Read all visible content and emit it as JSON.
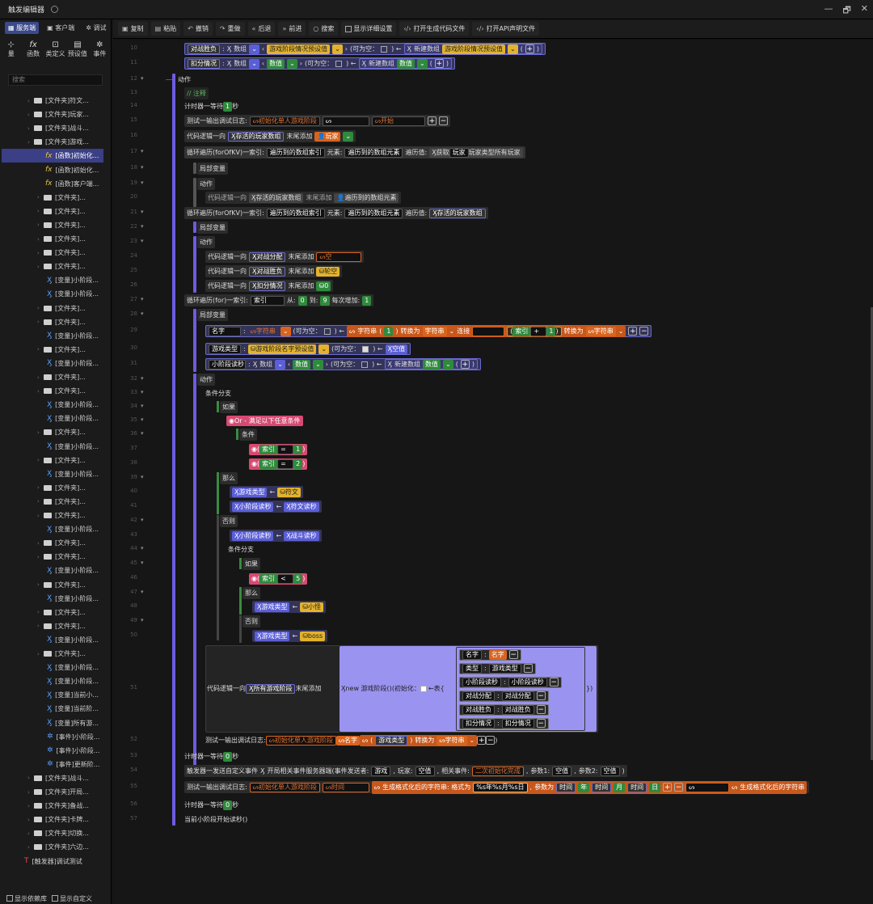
{
  "window": {
    "title": "触发编辑器",
    "controls": [
      "—",
      "🗗",
      "✕"
    ]
  },
  "left": {
    "tabs": [
      "服务端",
      "客户端",
      "调试"
    ],
    "tool_buttons": [
      "量",
      "函数",
      "类定义",
      "预设值",
      "事件"
    ],
    "search_placeholder": "搜索",
    "tree": [
      {
        "k": "folder",
        "t": "[文件夹]符文..."
      },
      {
        "k": "folder",
        "t": "[文件夹]玩家..."
      },
      {
        "k": "folder",
        "t": "[文件夹]战斗..."
      },
      {
        "k": "folder",
        "t": "[文件夹]游戏..."
      },
      {
        "k": "fx",
        "t": "[函数]初始化..."
      },
      {
        "k": "fx",
        "t": "[函数]初始化..."
      },
      {
        "k": "fx",
        "t": "[函数]客户端..."
      },
      {
        "k": "folder",
        "t": "[文件夹]..."
      },
      {
        "k": "folder",
        "t": "[文件夹]..."
      },
      {
        "k": "folder",
        "t": "[文件夹]..."
      },
      {
        "k": "folder",
        "t": "[文件夹]..."
      },
      {
        "k": "folder",
        "t": "[文件夹]..."
      },
      {
        "k": "folder",
        "t": "[文件夹]..."
      },
      {
        "k": "var",
        "t": "[变量]小阶段..."
      },
      {
        "k": "var",
        "t": "[变量]小阶段..."
      },
      {
        "k": "folder",
        "t": "[文件夹]..."
      },
      {
        "k": "folder",
        "t": "[文件夹]..."
      },
      {
        "k": "var",
        "t": "[变量]小阶段..."
      },
      {
        "k": "folder",
        "t": "[文件夹]..."
      },
      {
        "k": "var",
        "t": "[变量]小阶段..."
      },
      {
        "k": "folder",
        "t": "[文件夹]..."
      },
      {
        "k": "folder",
        "t": "[文件夹]..."
      },
      {
        "k": "var",
        "t": "[变量]小阶段..."
      },
      {
        "k": "var",
        "t": "[变量]小阶段..."
      },
      {
        "k": "folder",
        "t": "[文件夹]..."
      },
      {
        "k": "var",
        "t": "[变量]小阶段..."
      },
      {
        "k": "folder",
        "t": "[文件夹]..."
      },
      {
        "k": "var",
        "t": "[变量]小阶段..."
      },
      {
        "k": "folder",
        "t": "[文件夹]..."
      },
      {
        "k": "folder",
        "t": "[文件夹]..."
      },
      {
        "k": "folder",
        "t": "[文件夹]..."
      },
      {
        "k": "var",
        "t": "[变量]小阶段..."
      },
      {
        "k": "folder",
        "t": "[文件夹]..."
      },
      {
        "k": "folder",
        "t": "[文件夹]..."
      },
      {
        "k": "var",
        "t": "[变量]小阶段..."
      },
      {
        "k": "folder",
        "t": "[文件夹]..."
      },
      {
        "k": "var",
        "t": "[变量]小阶段..."
      },
      {
        "k": "folder",
        "t": "[文件夹]..."
      },
      {
        "k": "folder",
        "t": "[文件夹]..."
      },
      {
        "k": "var",
        "t": "[变量]小阶段..."
      },
      {
        "k": "folder",
        "t": "[文件夹]..."
      },
      {
        "k": "var",
        "t": "[变量]小阶段..."
      },
      {
        "k": "var",
        "t": "[变量]小阶段..."
      },
      {
        "k": "var",
        "t": "[变量]当前小..."
      },
      {
        "k": "var",
        "t": "[变量]当前阶..."
      },
      {
        "k": "var",
        "t": "[变量]所有游..."
      },
      {
        "k": "evt",
        "t": "[事件]小阶段..."
      },
      {
        "k": "evt",
        "t": "[事件]小阶段..."
      },
      {
        "k": "evt",
        "t": "[事件]更新阶..."
      },
      {
        "k": "folder",
        "t": "[文件夹]战斗..."
      },
      {
        "k": "folder",
        "t": "[文件夹]开局..."
      },
      {
        "k": "folder",
        "t": "[文件夹]备战..."
      },
      {
        "k": "folder",
        "t": "[文件夹]卡牌..."
      },
      {
        "k": "folder",
        "t": "[文件夹]切换..."
      },
      {
        "k": "folder",
        "t": "[文件夹]六边..."
      },
      {
        "k": "ttl",
        "t": "[触发器]调试测试"
      }
    ],
    "bottom": [
      "显示依赖库",
      "显示自定义"
    ]
  },
  "toolbar": [
    "复制",
    "粘贴",
    "撤销",
    "重做",
    "后退",
    "前进",
    "搜索",
    "显示详细设置",
    "打开生成代码文件",
    "打开API声明文件"
  ],
  "code": {
    "lines": [
      10,
      11,
      12,
      13,
      14,
      15,
      16,
      17,
      18,
      19,
      20,
      21,
      22,
      23,
      24,
      25,
      26,
      27,
      28,
      29,
      30,
      31,
      32,
      33,
      34,
      35,
      36,
      37,
      38,
      39,
      40,
      41,
      42,
      43,
      44,
      45,
      46,
      47,
      48,
      49,
      50,
      51,
      52,
      53,
      54,
      55,
      56,
      57
    ],
    "r10": {
      "name": "对战胜负",
      "t1": "数组",
      "t2": "游戏阶段情况预设值",
      "opt": "(可为空：",
      "new": "新建数组",
      "t3": "游戏阶段情况预设值"
    },
    "r11": {
      "name": "扣分情况",
      "t1": "数组",
      "t2": "数值",
      "opt": "(可为空：",
      "new": "新建数组",
      "t3": "数值"
    },
    "r12": "动作",
    "r13": "// 注释",
    "r14": {
      "a": "计时器一等待",
      "v": "1",
      "u": "秒"
    },
    "r15": {
      "a": "测试一输出调试日志:",
      "s1": "初始化单人游戏阶段",
      "s3": "开始"
    },
    "r16": {
      "a": "代码逻辑一向",
      "v": "存活的玩家数组",
      "b": "末尾添加",
      "p": "玩家"
    },
    "r17": {
      "a": "循环遍历(forOfKV)一索引:",
      "i": "遍历到的数组索引",
      "e": "元素:",
      "ev": "遍历到的数组元素",
      "s": "遍历值:",
      "g": "获取",
      "pl": "玩家",
      "pa": "玩家类型所有玩家"
    },
    "r18": "局部变量",
    "r19": "动作",
    "r20": {
      "a": "代码逻辑一向",
      "v": "存活的玩家数组",
      "b": "末尾添加",
      "p": "遍历到的数组元素"
    },
    "r21": {
      "a": "循环遍历(forOfKV)一索引:",
      "i": "遍历到的数组索引",
      "e": "元素:",
      "ev": "遍历到的数组元素",
      "s": "遍历值:",
      "sv": "存活的玩家数组"
    },
    "r22": "局部变量",
    "r23": "动作",
    "r24": {
      "a": "代码逻辑一向",
      "v": "对战分配",
      "b": "末尾添加",
      "p": "空"
    },
    "r25": {
      "a": "代码逻辑一向",
      "v": "对战胜负",
      "b": "末尾添加",
      "p": "轮空"
    },
    "r26": {
      "a": "代码逻辑一向",
      "v": "扣分情况",
      "b": "末尾添加",
      "p": "0"
    },
    "r27": {
      "a": "循环遍历(for)一索引:",
      "i": "索引",
      "f": "从:",
      "fv": "0",
      "to": "到:",
      "tv": "9",
      "st": "每次增加:",
      "sv": "1"
    },
    "r28": "局部变量",
    "r29": {
      "n": "名字",
      "t": "字符串",
      "opt": "(可为空：",
      "s": "字符串",
      "c": "转换为",
      "s2": "字符串",
      "cat": "连接",
      "idx": "索引",
      "op": "+",
      "v": "1",
      "s3": "字符串",
      "one": "1"
    },
    "r30": {
      "n": "游戏类型",
      "t": "游戏阶段名字预设值",
      "opt": "(可为空：",
      "v": "空值"
    },
    "r31": {
      "n": "小阶段读秒",
      "t1": "数组",
      "t2": "数值",
      "opt": "(可为空：",
      "new": "新建数组",
      "t3": "数值"
    },
    "r32": "动作",
    "r33": "条件分支",
    "r34": "如果",
    "r35": "Or - 满足以下任意条件",
    "r36": "条件",
    "r37": {
      "i": "索引",
      "op": "=",
      "v": "1"
    },
    "r38": {
      "i": "索引",
      "op": "=",
      "v": "2"
    },
    "r39": "那么",
    "r40": {
      "v": "游戏类型",
      "p": "符文"
    },
    "r41": {
      "v": "小阶段读秒",
      "p": "符文读秒"
    },
    "r42": "否则",
    "r43": {
      "v": "小阶段读秒",
      "p": "战斗读秒"
    },
    "r44": "条件分支",
    "r45": "如果",
    "r46": {
      "i": "索引",
      "op": "<",
      "v": "5"
    },
    "r47": "那么",
    "r48": {
      "v": "游戏类型",
      "p": "小怪"
    },
    "r49": "否则",
    "r50": {
      "v": "游戏类型",
      "p": "boss"
    },
    "r51": {
      "a": "代码逻辑一向",
      "v": "所有游戏阶段",
      "b": "末尾添加",
      "new": "new 游戏阶段()",
      "init": "(初始化：",
      "tbl": "表{",
      "fields": [
        [
          "名字",
          "名字"
        ],
        [
          "类型",
          "游戏类型"
        ],
        [
          "小阶段读秒",
          "小阶段读秒"
        ],
        [
          "对战分配",
          "对战分配"
        ],
        [
          "对战胜负",
          "对战胜负"
        ],
        [
          "扣分情况",
          "扣分情况"
        ]
      ]
    },
    "r52": {
      "a": "测试一输出调试日志:",
      "s1": "初始化单人游戏阶段",
      "s2": "名字",
      "v": "游戏类型",
      "c": "转换为",
      "s3": "字符串"
    },
    "r53": {
      "a": "计时器一等待",
      "v": "0",
      "u": "秒"
    },
    "r54": {
      "a": "触发器一发送自定义事件",
      "e": "开局相关事件服务器端(事件发送者:",
      "s": "游戏",
      "p": "玩家:",
      "pv": "空值",
      "r": "相关事件:",
      "rv": "二次初始化完成",
      "p1": "参数1:",
      "p1v": "空值",
      "p2": "参数2:",
      "p2v": "空值"
    },
    "r55": {
      "a": "测试一输出调试日志:",
      "s1": "初始化单人游戏阶段",
      "s2": "时间",
      "g": "生成格式化后的字符串: 格式为",
      "fmt": "%s年%s月%s日",
      "pw": "参数为",
      "t1": "时间",
      "y": "年",
      "t2": "时间",
      "m": "月",
      "t3": "时间",
      "d": "日",
      "g2": "生成格式化后的字符串"
    },
    "r56": {
      "a": "计时器一等待",
      "v": "0",
      "u": "秒"
    },
    "r57": "当前小阶段开始读秒()"
  }
}
